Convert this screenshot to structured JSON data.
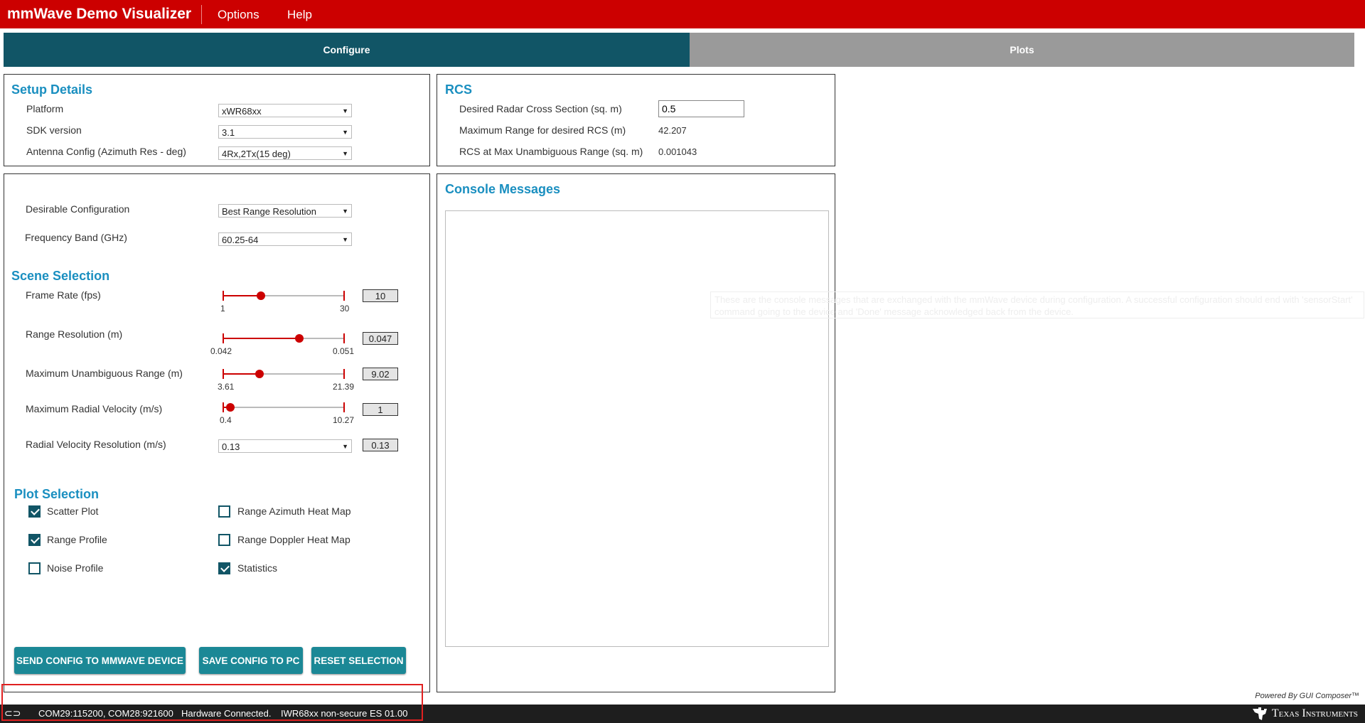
{
  "header": {
    "title": "mmWave Demo Visualizer",
    "menu": [
      "Options",
      "Help"
    ]
  },
  "tabs": [
    {
      "label": "Configure"
    },
    {
      "label": "Plots"
    }
  ],
  "setup": {
    "heading": "Setup Details",
    "rows": [
      {
        "label": "Platform",
        "value": "xWR68xx"
      },
      {
        "label": "SDK version",
        "value": "3.1"
      },
      {
        "label": "Antenna Config (Azimuth Res - deg)",
        "value": "4Rx,2Tx(15 deg)"
      }
    ]
  },
  "rcs": {
    "heading": "RCS",
    "desired_label": "Desired Radar Cross Section (sq. m)",
    "desired_value": "0.5",
    "max_range_label": "Maximum Range for desired RCS (m)",
    "max_range_value": "42.207",
    "rcs_max_label": "RCS at Max Unambiguous Range (sq. m)",
    "rcs_max_value": "0.001043"
  },
  "config": {
    "desirable_label": "Desirable Configuration",
    "desirable_value": "Best Range Resolution",
    "freq_label": "Frequency Band (GHz)",
    "freq_value": "60.25-64"
  },
  "scene": {
    "heading": "Scene Selection",
    "sliders": [
      {
        "label": "Frame Rate (fps)",
        "min": "1",
        "max": "30",
        "value": "10",
        "fraction": 0.31
      },
      {
        "label": "Range Resolution (m)",
        "min": "0.042",
        "max": "0.051",
        "value": "0.047",
        "fraction": 0.63
      },
      {
        "label": "Maximum Unambiguous Range (m)",
        "min": "3.61",
        "max": "21.39",
        "value": "9.02",
        "fraction": 0.3
      },
      {
        "label": "Maximum Radial Velocity (m/s)",
        "min": "0.4",
        "max": "10.27",
        "value": "1",
        "fraction": 0.06
      }
    ],
    "velres_label": "Radial Velocity Resolution (m/s)",
    "velres_select": "0.13",
    "velres_value": "0.13"
  },
  "plots": {
    "heading": "Plot Selection",
    "items": [
      {
        "label": "Scatter Plot",
        "checked": true
      },
      {
        "label": "Range Azimuth Heat Map",
        "checked": false
      },
      {
        "label": "Range Profile",
        "checked": true
      },
      {
        "label": "Range Doppler Heat Map",
        "checked": false
      },
      {
        "label": "Noise Profile",
        "checked": false
      },
      {
        "label": "Statistics",
        "checked": true
      }
    ]
  },
  "buttons": {
    "send": "SEND CONFIG TO MMWAVE DEVICE",
    "save": "SAVE CONFIG TO PC",
    "reset": "RESET SELECTION"
  },
  "console": {
    "heading": "Console Messages"
  },
  "tooltip": "These are the console messages that are exchanged with the mmWave device during configuration. A successful configuration should end with 'sensorStart' command going to the device and 'Done' message acknowledged back from the device.",
  "footer": {
    "powered": "Powered By GUI Composer™",
    "brand": "Texas Instruments"
  },
  "status": {
    "ports": "COM29:115200, COM28:921600",
    "hw": "Hardware Connected.",
    "device": "IWR68xx non-secure ES 01.00"
  },
  "colors": {
    "brand_red": "#cc0000",
    "tab_active": "#115566",
    "heading": "#1a8fc0",
    "button": "#1b8896"
  }
}
